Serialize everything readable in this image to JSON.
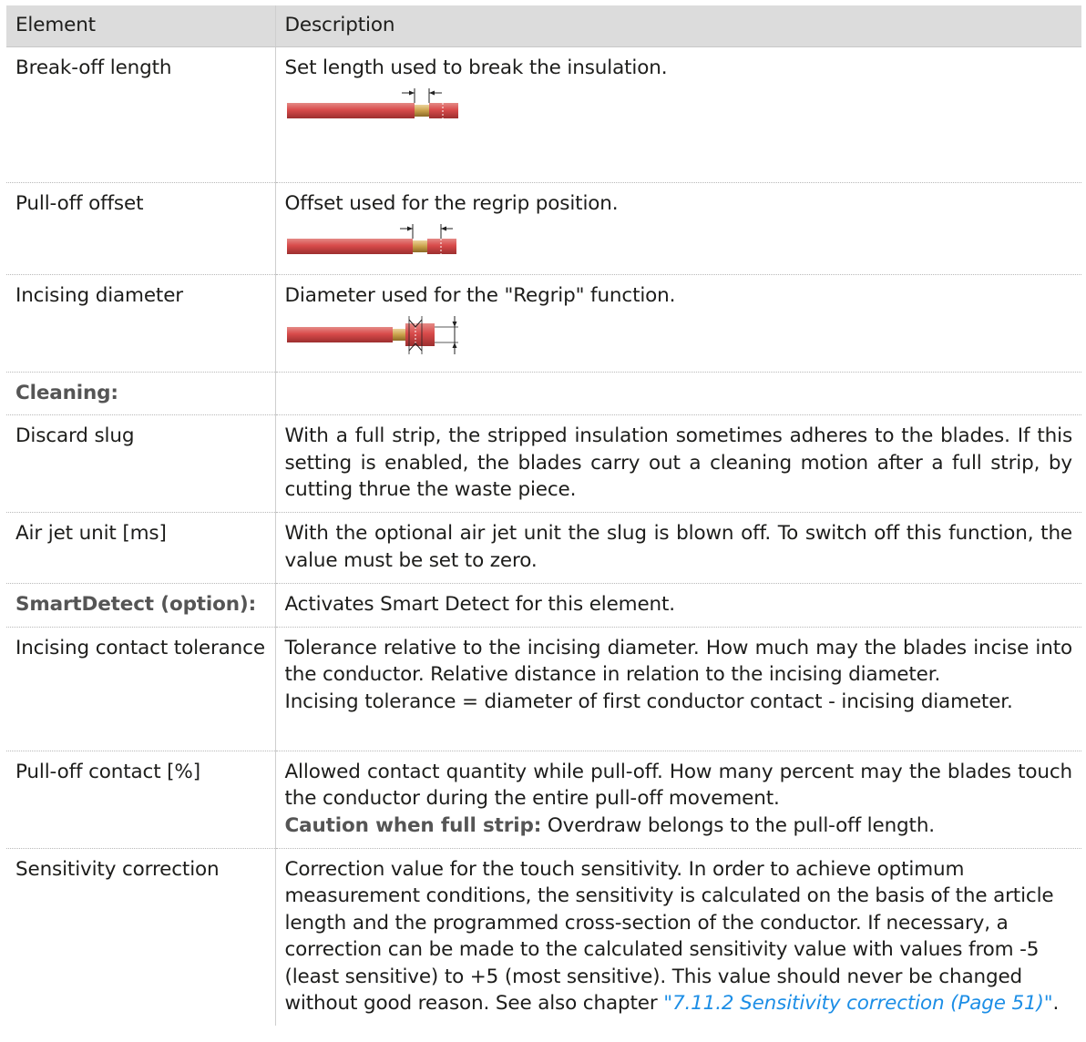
{
  "table": {
    "header": {
      "element": "Element",
      "description": "Description"
    },
    "rows": [
      {
        "element": "Break-off length",
        "description": "Set length used to break the insulation.",
        "figure": "break-off-length-diagram"
      },
      {
        "element": "Pull-off offset",
        "description": "Offset used for the regrip position.",
        "figure": "pull-off-offset-diagram"
      },
      {
        "element": "Incising diameter",
        "description": "Diameter used for the \"Regrip\" function.",
        "figure": "incising-diameter-diagram"
      },
      {
        "element": "Cleaning:",
        "description": ""
      },
      {
        "element": "Discard slug",
        "description": "With a full strip, the stripped insulation sometimes adheres to the blades. If this setting is enabled, the blades carry out a cleaning motion after a full strip, by cutting thrue the waste piece."
      },
      {
        "element": "Air jet unit [ms]",
        "description": "With the optional air jet unit the slug is blown off. To switch off this function, the value must be set to zero."
      },
      {
        "element": "SmartDetect (option):",
        "description": "Activates Smart Detect for this element."
      },
      {
        "element": "Incising contact tolerance",
        "description": "Tolerance relative to the incising diameter. How much may the blades incise into the conductor. Relative distance in relation to the incising diameter.",
        "description2": "Incising tolerance = diameter of first conductor contact - incising diameter."
      },
      {
        "element": "Pull-off contact [%]",
        "description": "Allowed contact quantity while pull-off. How many percent may the blades touch the conductor during the entire pull-off movement.",
        "caution_label": "Caution when full strip:",
        "caution_text": " Overdraw belongs to the pull-off length."
      },
      {
        "element": "Sensitivity correction",
        "description": "Correction value for the touch sensitivity. In order to achieve optimum measurement conditions, the sensitivity is calculated on the basis of the article length and the programmed cross-section of the conductor. If necessary, a correction can be made to the calculated sensitivity value with values from -5 (least sensitive) to +5 (most sensitive). This value should never be changed without good reason. See also chapter ",
        "link_text": "\"7.11.2 Sensitivity correction (Page 51)\"",
        "tail": "."
      }
    ]
  },
  "colors": {
    "header_bg": "#dcdcdc",
    "link": "#1c8ee6",
    "cable_red": "#d84a4a",
    "conductor_gold": "#c9a04a"
  }
}
